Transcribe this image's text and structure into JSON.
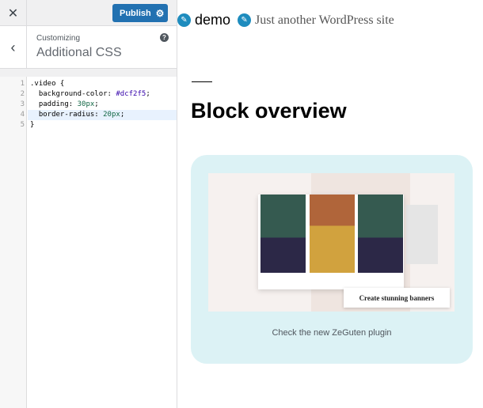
{
  "sidebar": {
    "publish_label": "Publish",
    "customizing_label": "Customizing",
    "section_title": "Additional CSS",
    "code_lines": [
      {
        "n": "1",
        "text": ".video {"
      },
      {
        "n": "2",
        "prop": "  background-color: ",
        "val": "#dcf2f5",
        "end": ";"
      },
      {
        "n": "3",
        "prop": "  padding: ",
        "val": "30px",
        "end": ";"
      },
      {
        "n": "4",
        "prop": "  border-radius: ",
        "val": "20px",
        "end": ";"
      },
      {
        "n": "5",
        "text": "}"
      }
    ]
  },
  "site": {
    "title": "demo",
    "tagline": "Just another WordPress site"
  },
  "content": {
    "heading": "Block overview",
    "banner_text": "Create stunning banners",
    "caption": "Check the new ZeGuten plugin",
    "video_bg": "#dcf2f5"
  },
  "colors": {
    "accent": "#2271b1",
    "edit_icon": "#1e8cbe"
  }
}
